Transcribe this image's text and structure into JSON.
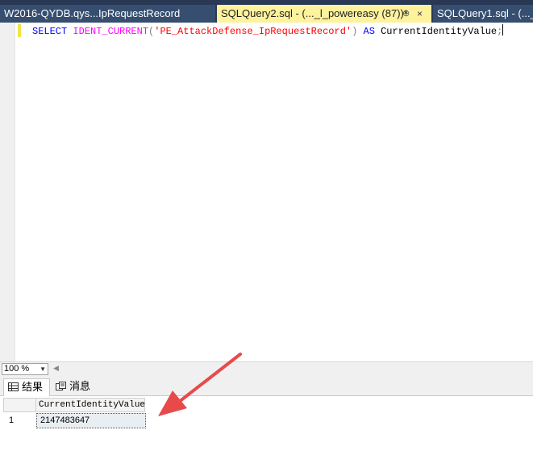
{
  "tabs": [
    {
      "label": "W2016-QYDB.qys...IpRequestRecord",
      "active": false
    },
    {
      "label": "SQLQuery2.sql - (..._l_powereasy (87))*",
      "active": true
    },
    {
      "label": "SQLQuery1.sql - (..._l_",
      "active": false
    }
  ],
  "tab_pin_glyph": "⊕",
  "tab_close_glyph": "×",
  "editor": {
    "kw_select": "SELECT",
    "fn_name": "IDENT_CURRENT",
    "paren_open": "(",
    "str_arg": "'PE_AttackDefense_IpRequestRecord'",
    "paren_close": ")",
    "kw_as": "AS",
    "alias": "CurrentIdentityValue",
    "semicolon": ";"
  },
  "zoom": {
    "value": "100 %"
  },
  "results": {
    "tab_results": "结果",
    "tab_messages": "消息",
    "column_header": "CurrentIdentityValue",
    "row_number": "1",
    "cell_value": "2147483647"
  },
  "colors": {
    "tabbar_bg": "#293955",
    "active_tab_bg": "#fff29d",
    "keyword": "#0000ff",
    "function": "#ff00ff",
    "string": "#ff0000",
    "arrow": "#e84a4a"
  }
}
